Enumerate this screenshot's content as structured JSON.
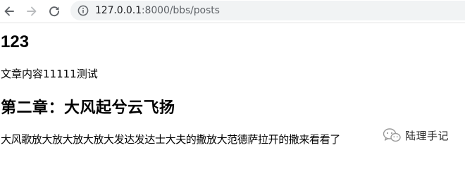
{
  "browser": {
    "url_host": "127.0.0.1",
    "url_path": ":8000/bbs/posts"
  },
  "posts": [
    {
      "title": "123",
      "body": "文章内容11111测试"
    },
    {
      "title": "第二章：大风起兮云飞扬",
      "body": "大风歌放大放大放大放大发达发达士大夫的撒放大范德萨拉开的撒来看看了"
    }
  ],
  "watermark": {
    "text": "陆理手记"
  }
}
